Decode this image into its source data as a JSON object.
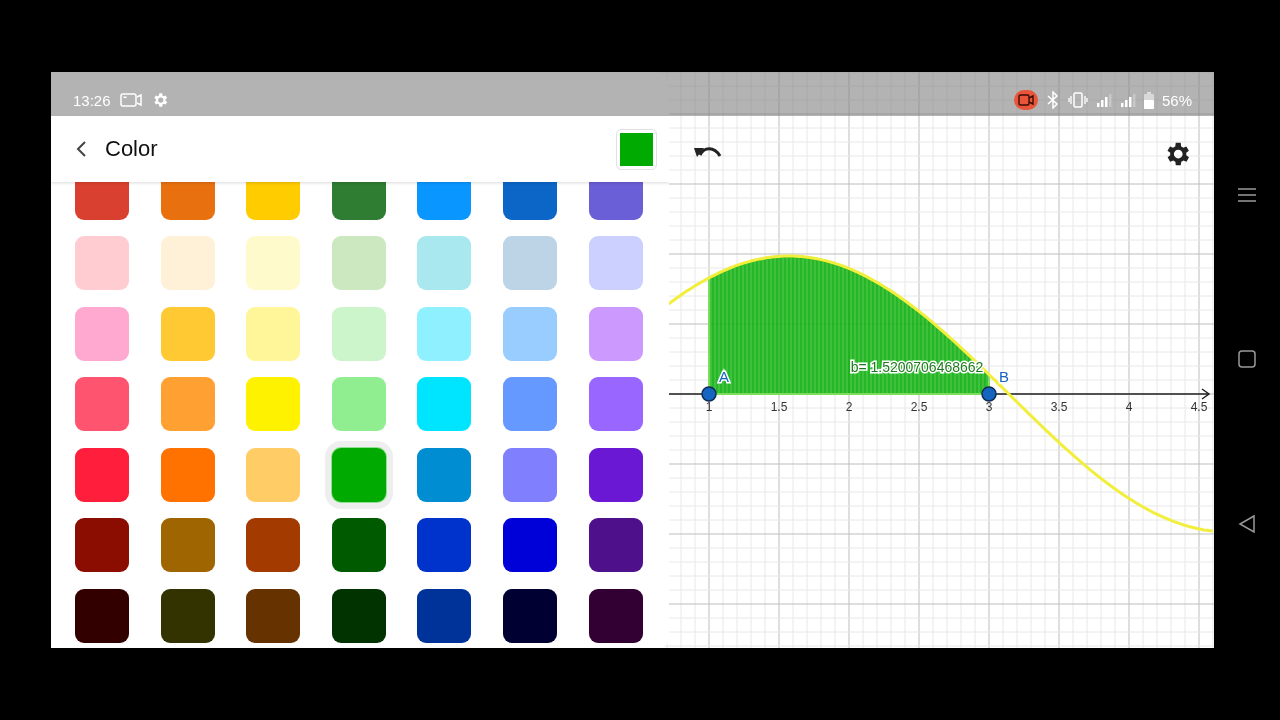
{
  "status_bar": {
    "time": "13:26",
    "battery": "56%"
  },
  "color_panel": {
    "title": "Color",
    "current_swatch": {
      "color": "#00aa00"
    },
    "swatches": [
      {
        "color": "#d9402f",
        "selected": false
      },
      {
        "color": "#e8700f",
        "selected": false
      },
      {
        "color": "#ffcc00",
        "selected": false
      },
      {
        "color": "#2e7d32",
        "selected": false
      },
      {
        "color": "#0a96ff",
        "selected": false
      },
      {
        "color": "#0b66c8",
        "selected": false
      },
      {
        "color": "#6a5fd6",
        "selected": false
      },
      {
        "color": "#ffccd1",
        "selected": false
      },
      {
        "color": "#fff0d8",
        "selected": false
      },
      {
        "color": "#fffacc",
        "selected": false
      },
      {
        "color": "#cbe8c0",
        "selected": false
      },
      {
        "color": "#a8e8ee",
        "selected": false
      },
      {
        "color": "#bcd4e6",
        "selected": false
      },
      {
        "color": "#ccd0ff",
        "selected": false
      },
      {
        "color": "#ffa8d0",
        "selected": false
      },
      {
        "color": "#ffc933",
        "selected": false
      },
      {
        "color": "#fff599",
        "selected": false
      },
      {
        "color": "#ccf5cc",
        "selected": false
      },
      {
        "color": "#8ff0ff",
        "selected": false
      },
      {
        "color": "#99ccff",
        "selected": false
      },
      {
        "color": "#cc99ff",
        "selected": false
      },
      {
        "color": "#ff5470",
        "selected": false
      },
      {
        "color": "#ffa033",
        "selected": false
      },
      {
        "color": "#fff200",
        "selected": false
      },
      {
        "color": "#90ee90",
        "selected": false
      },
      {
        "color": "#00e5ff",
        "selected": false
      },
      {
        "color": "#6699ff",
        "selected": false
      },
      {
        "color": "#9966ff",
        "selected": false
      },
      {
        "color": "#ff1e3c",
        "selected": false
      },
      {
        "color": "#ff7200",
        "selected": false
      },
      {
        "color": "#ffcc66",
        "selected": false
      },
      {
        "color": "#00aa00",
        "selected": true
      },
      {
        "color": "#008dd1",
        "selected": false
      },
      {
        "color": "#8080ff",
        "selected": false
      },
      {
        "color": "#6b18d4",
        "selected": false
      },
      {
        "color": "#8b0c00",
        "selected": false
      },
      {
        "color": "#9e6500",
        "selected": false
      },
      {
        "color": "#a33b00",
        "selected": false
      },
      {
        "color": "#005a00",
        "selected": false
      },
      {
        "color": "#0033cc",
        "selected": false
      },
      {
        "color": "#0000d9",
        "selected": false
      },
      {
        "color": "#4f108b",
        "selected": false
      },
      {
        "color": "#330000",
        "selected": false
      },
      {
        "color": "#333300",
        "selected": false
      },
      {
        "color": "#663300",
        "selected": false
      },
      {
        "color": "#003300",
        "selected": false
      },
      {
        "color": "#003399",
        "selected": false
      },
      {
        "color": "#000033",
        "selected": false
      },
      {
        "color": "#330033",
        "selected": false
      }
    ]
  },
  "graph": {
    "tick_labels": [
      "1",
      "1.5",
      "2",
      "2.5",
      "3",
      "3.5",
      "4",
      "4.5"
    ],
    "points": [
      {
        "label": "A"
      },
      {
        "label": "B"
      }
    ],
    "value_label": "b= 1.5200706468662"
  }
}
